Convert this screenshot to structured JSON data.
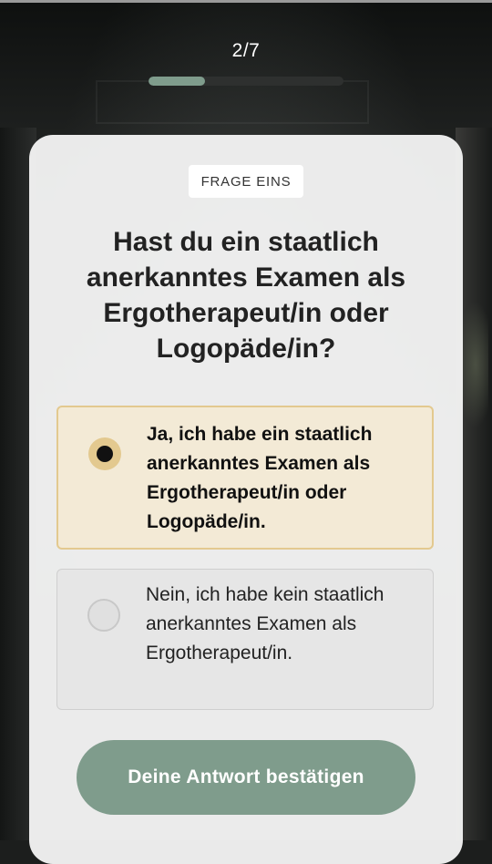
{
  "header": {
    "step_label": "2/7",
    "progress_fraction": 0.29
  },
  "card": {
    "tag": "FRAGE EINS",
    "question": "Hast du ein staatlich anerkanntes Examen als Ergotherapeut/in oder Logopäde/in?",
    "options": [
      {
        "label": "Ja, ich habe ein staatlich anerkanntes Examen als Ergotherapeut/in oder Logopäde/in.",
        "selected": true
      },
      {
        "label": "Nein, ich habe kein staatlich anerkanntes Examen als Ergotherapeut/in.",
        "selected": false
      }
    ],
    "confirm_label": "Deine Antwort bestätigen"
  },
  "colors": {
    "accent_green": "#7f9c8c",
    "selected_border": "#e3c98f",
    "selected_bg": "#f3ead6"
  }
}
